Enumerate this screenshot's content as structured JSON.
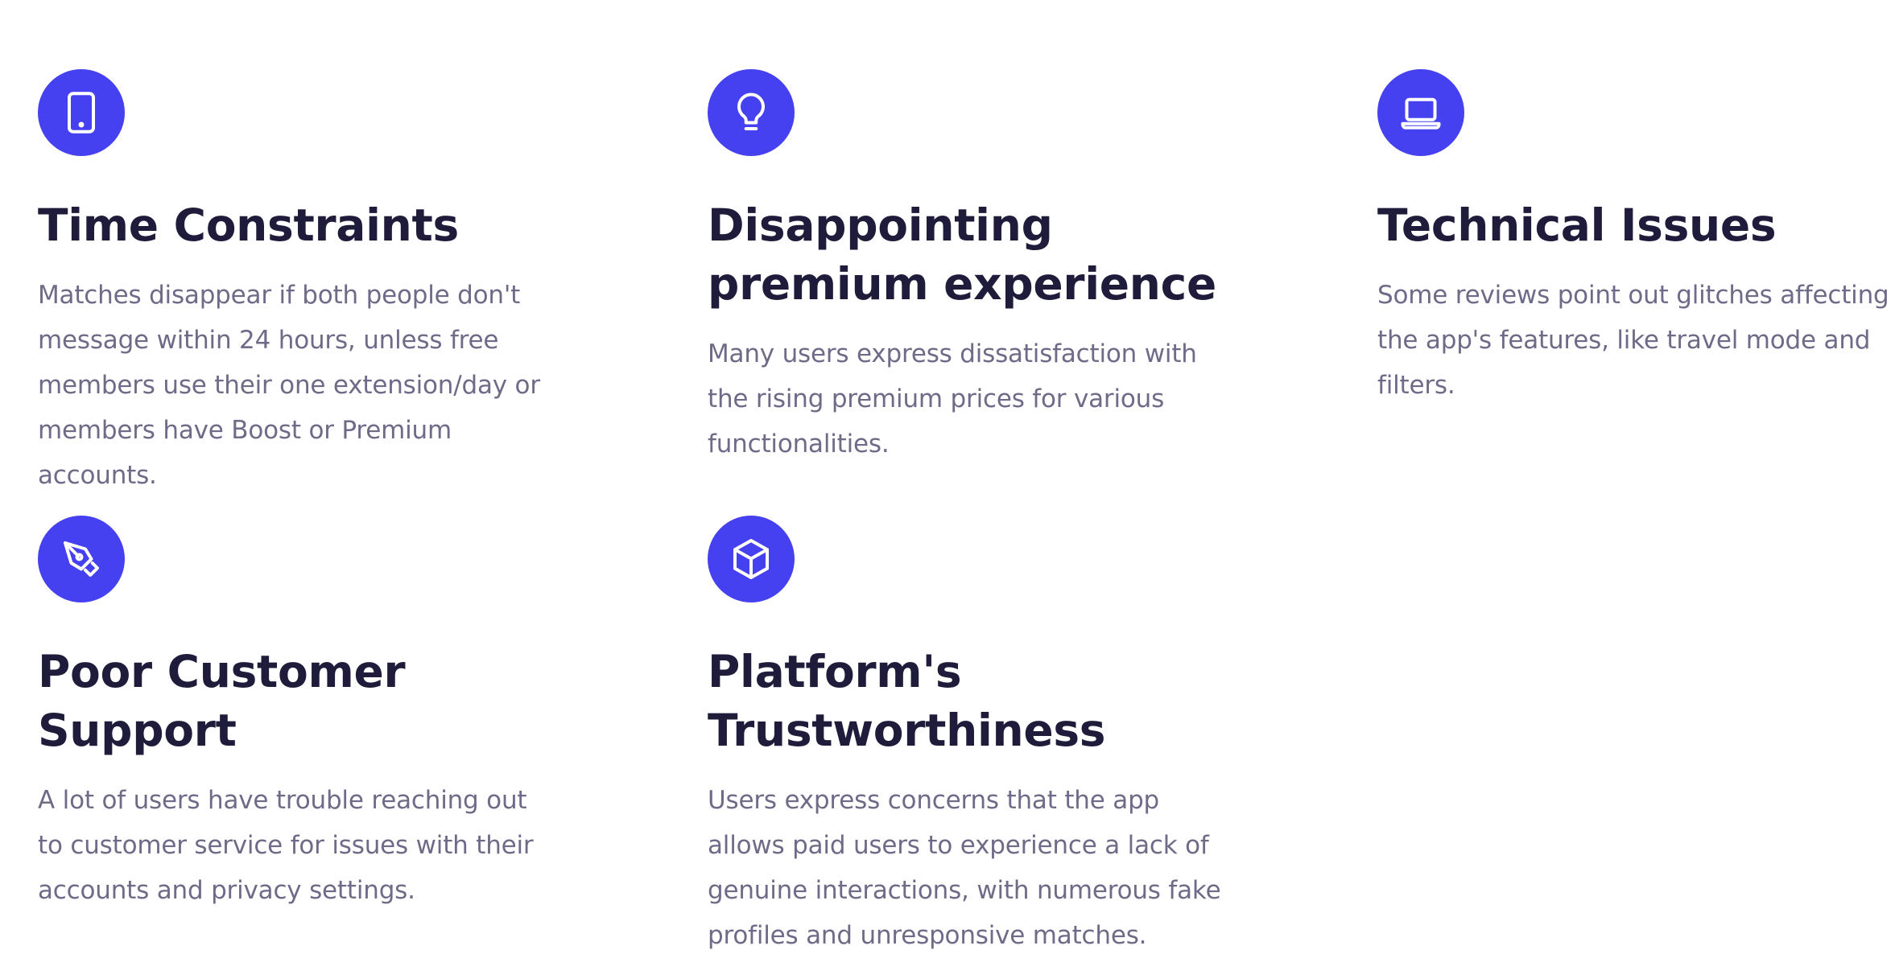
{
  "colors": {
    "accent": "#4540f0",
    "title": "#1f1b3a",
    "body": "#6e6b88",
    "background": "#ffffff"
  },
  "features": [
    {
      "icon": "tablet-icon",
      "title": "Time Constraints",
      "description": "Matches disappear if both people don't message within 24 hours, unless free members use their one extension/day or members have Boost or Premium accounts."
    },
    {
      "icon": "lightbulb-icon",
      "title": "Disappointing premium experience",
      "description": "Many users express dissatisfaction with the rising premium prices for various functionalities."
    },
    {
      "icon": "laptop-icon",
      "title": "Technical Issues",
      "description": "Some reviews point out glitches affecting the app's features, like travel mode and filters."
    },
    {
      "icon": "pen-nib-icon",
      "title": "Poor Customer Support",
      "description": "A lot of users have trouble reaching out to customer service for issues with their accounts and privacy settings."
    },
    {
      "icon": "cube-icon",
      "title": "Platform's Trustworthiness",
      "description": "Users express concerns that the app allows paid users to experience a lack of genuine interactions, with numerous fake profiles and unresponsive matches."
    }
  ]
}
